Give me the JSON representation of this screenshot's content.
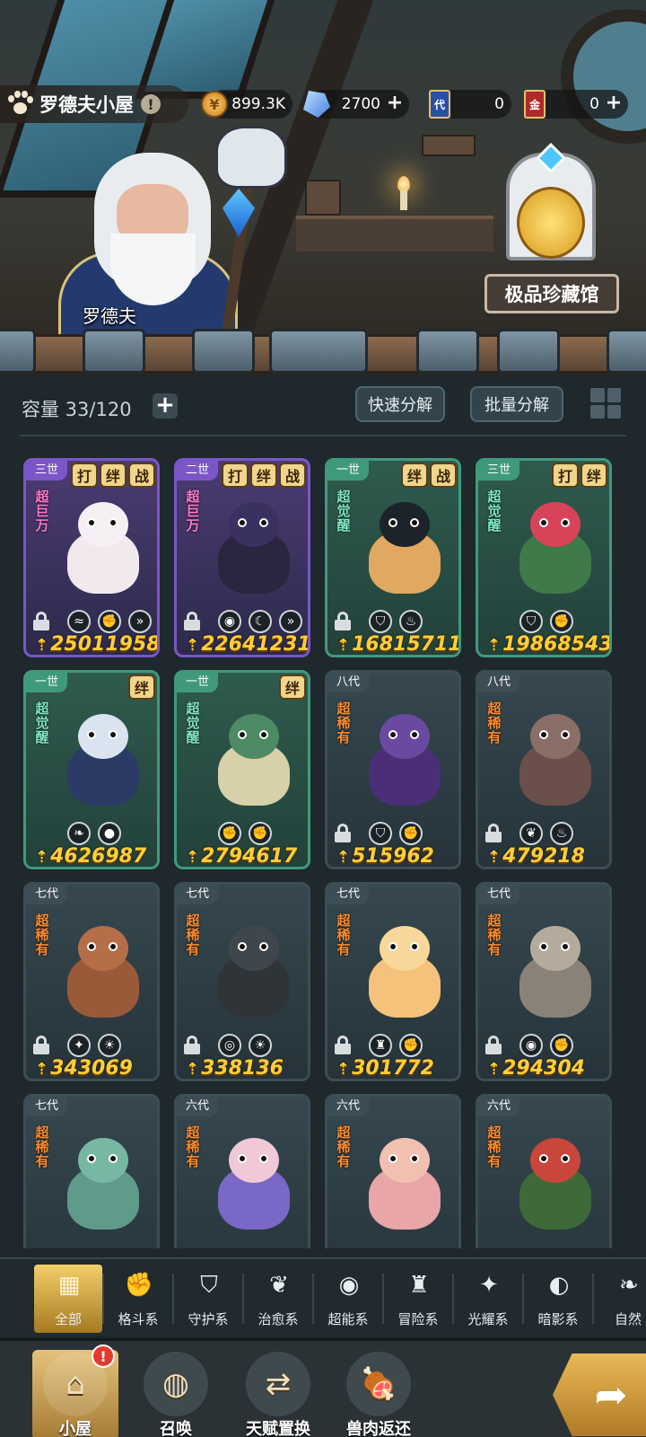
{
  "header": {
    "title": "罗德夫小屋",
    "info_glyph": "!",
    "currencies": [
      {
        "name": "gold-coin",
        "value": "899.3K",
        "has_plus": true
      },
      {
        "name": "crystal",
        "value": "2700",
        "has_plus": true
      },
      {
        "name": "card-dai",
        "icon_text": "代",
        "value": "0",
        "has_plus": false
      },
      {
        "name": "card-jin",
        "icon_text": "金",
        "value": "0",
        "has_plus": true
      }
    ]
  },
  "scene": {
    "character_name": "罗德夫",
    "museum_label": "极品珍藏馆"
  },
  "storage": {
    "capacity_label": "容量 33/120",
    "quick_decompose": "快速分解",
    "batch_decompose": "批量分解"
  },
  "cards": [
    {
      "gen": "三世",
      "badges": [
        "打",
        "绊",
        "战"
      ],
      "rarity": "超巨万",
      "style": "purple",
      "locked": true,
      "elements": [
        "whale-icon",
        "fist-icon",
        "chevron-icon"
      ],
      "power": "25011958",
      "colors": {
        "body": "#f2e9ee",
        "head": "#f6f0f4"
      }
    },
    {
      "gen": "二世",
      "badges": [
        "打",
        "绊",
        "战"
      ],
      "rarity": "超巨万",
      "style": "purple",
      "locked": true,
      "elements": [
        "eye-icon",
        "moon-icon",
        "chevron-icon"
      ],
      "power": "22641231",
      "colors": {
        "body": "#2b2540",
        "head": "#3a3160"
      }
    },
    {
      "gen": "一世",
      "badges": [
        "绊",
        "战"
      ],
      "rarity": "超觉醒",
      "style": "green",
      "locked": true,
      "elements": [
        "shield-icon",
        "flame-icon"
      ],
      "power": "16815711",
      "colors": {
        "body": "#e0a860",
        "head": "#1d232a"
      }
    },
    {
      "gen": "三世",
      "badges": [
        "打",
        "绊"
      ],
      "rarity": "超觉醒",
      "style": "green",
      "locked": false,
      "elements": [
        "shield-icon",
        "fist-icon"
      ],
      "power": "19868543",
      "colors": {
        "body": "#3e7a4a",
        "head": "#d8435a"
      }
    },
    {
      "gen": "一世",
      "badges": [
        "绊"
      ],
      "rarity": "超觉醒",
      "style": "green",
      "locked": false,
      "elements": [
        "leaf-icon",
        "water-drop-icon"
      ],
      "power": "4626987",
      "colors": {
        "body": "#2c3a66",
        "head": "#d9e4f0"
      }
    },
    {
      "gen": "一世",
      "badges": [
        "绊"
      ],
      "rarity": "超觉醒",
      "style": "green",
      "locked": false,
      "elements": [
        "fist-icon",
        "fist-icon"
      ],
      "power": "2794617",
      "colors": {
        "body": "#d8d0a8",
        "head": "#4e8a64"
      }
    },
    {
      "gen": "八代",
      "badges": [],
      "rarity": "超稀有",
      "style": "blue",
      "locked": true,
      "elements": [
        "shield-icon",
        "fist-icon"
      ],
      "power": "515962",
      "colors": {
        "body": "#4a2f78",
        "head": "#6a4aa0"
      }
    },
    {
      "gen": "八代",
      "badges": [],
      "rarity": "超稀有",
      "style": "blue",
      "locked": true,
      "elements": [
        "sprout-icon",
        "flame-icon"
      ],
      "power": "479218",
      "colors": {
        "body": "#6a4f4a",
        "head": "#8a6e68"
      }
    },
    {
      "gen": "七代",
      "badges": [],
      "rarity": "超稀有",
      "style": "blue",
      "locked": true,
      "elements": [
        "compass-icon",
        "sun-icon"
      ],
      "power": "343069",
      "colors": {
        "body": "#9a5a3a",
        "head": "#b56e48"
      }
    },
    {
      "gen": "七代",
      "badges": [],
      "rarity": "超稀有",
      "style": "blue",
      "locked": true,
      "elements": [
        "psychic-icon",
        "sun-icon"
      ],
      "power": "338136",
      "colors": {
        "body": "#2f3438",
        "head": "#3f474d"
      }
    },
    {
      "gen": "七代",
      "badges": [],
      "rarity": "超稀有",
      "style": "blue",
      "locked": true,
      "elements": [
        "lantern-icon",
        "fist-icon"
      ],
      "power": "301772",
      "colors": {
        "body": "#f4c27a",
        "head": "#f8d79a"
      }
    },
    {
      "gen": "七代",
      "badges": [],
      "rarity": "超稀有",
      "style": "blue",
      "locked": true,
      "elements": [
        "eye-icon",
        "fist-icon"
      ],
      "power": "294304",
      "colors": {
        "body": "#8a8276",
        "head": "#b5ab9c"
      }
    },
    {
      "gen": "七代",
      "badges": [],
      "rarity": "超稀有",
      "style": "blue",
      "locked": false,
      "elements": [],
      "power": "",
      "colors": {
        "body": "#5f9a8a",
        "head": "#78b7a4"
      }
    },
    {
      "gen": "六代",
      "badges": [],
      "rarity": "超稀有",
      "style": "blue",
      "locked": false,
      "elements": [],
      "power": "",
      "colors": {
        "body": "#7a68c6",
        "head": "#f0c8d8"
      }
    },
    {
      "gen": "六代",
      "badges": [],
      "rarity": "超稀有",
      "style": "blue",
      "locked": false,
      "elements": [],
      "power": "",
      "colors": {
        "body": "#e8a6a8",
        "head": "#f2c0b0"
      }
    },
    {
      "gen": "六代",
      "badges": [],
      "rarity": "超稀有",
      "style": "blue",
      "locked": false,
      "elements": [],
      "power": "",
      "colors": {
        "body": "#3e6a3a",
        "head": "#c9463a"
      }
    }
  ],
  "filters": [
    {
      "label": "全部",
      "icon": "all-icon",
      "glyph": "▦",
      "active": true
    },
    {
      "label": "格斗系",
      "icon": "fist-icon",
      "glyph": "✊",
      "active": false
    },
    {
      "label": "守护系",
      "icon": "shield-icon",
      "glyph": "⛉",
      "active": false
    },
    {
      "label": "治愈系",
      "icon": "sprout-icon",
      "glyph": "❦",
      "active": false
    },
    {
      "label": "超能系",
      "icon": "psychic-icon",
      "glyph": "◉",
      "active": false
    },
    {
      "label": "冒险系",
      "icon": "lantern-icon",
      "glyph": "♜",
      "active": false
    },
    {
      "label": "光耀系",
      "icon": "compass-icon",
      "glyph": "✦",
      "active": false
    },
    {
      "label": "暗影系",
      "icon": "eye-icon",
      "glyph": "◐",
      "active": false
    },
    {
      "label": "自然",
      "icon": "leaf-icon",
      "glyph": "❧",
      "active": false
    }
  ],
  "nav": [
    {
      "label": "小屋",
      "icon": "house-icon",
      "glyph": "⌂",
      "active": true,
      "alert": "!"
    },
    {
      "label": "召唤",
      "icon": "egg-icon",
      "glyph": "◍",
      "active": false,
      "alert": ""
    },
    {
      "label": "天赋置换",
      "icon": "swap-icon",
      "glyph": "⇄",
      "active": false,
      "alert": ""
    },
    {
      "label": "兽肉返还",
      "icon": "meat-icon",
      "glyph": "🍖",
      "active": false,
      "alert": ""
    }
  ],
  "colors": {
    "power": "#ffce3a",
    "badge": "#f0d58a",
    "active_gold": "#f3cf6a",
    "alert": "#e53b2c"
  }
}
